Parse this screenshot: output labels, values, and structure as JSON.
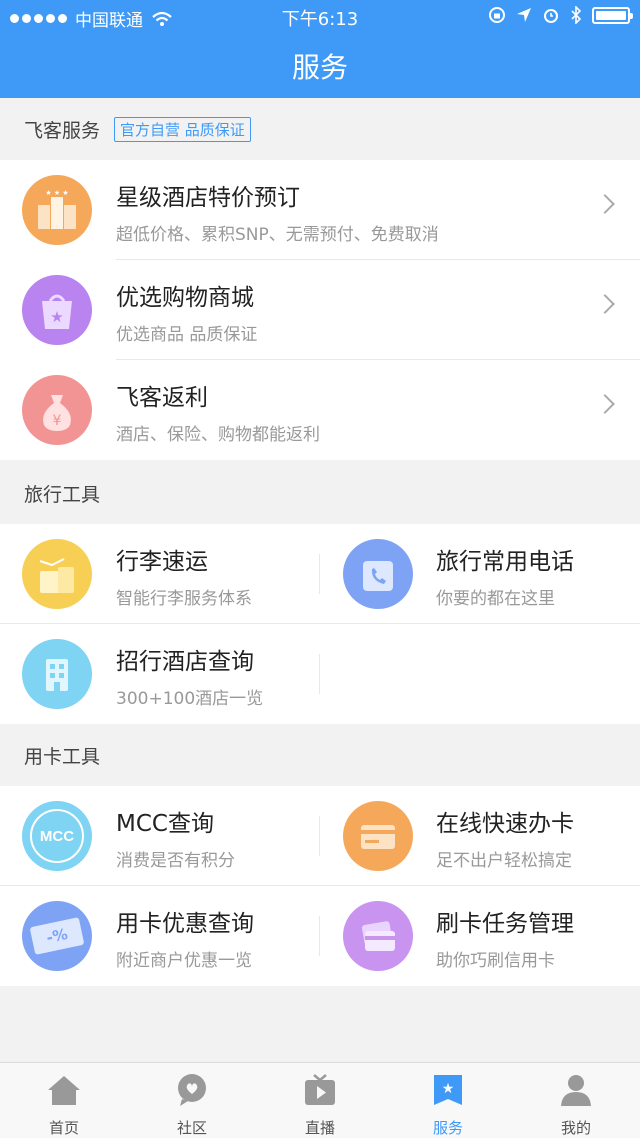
{
  "status": {
    "carrier": "中国联通",
    "time": "下午6:13"
  },
  "header": {
    "title": "服务"
  },
  "sections": {
    "feike": {
      "title": "飞客服务",
      "tag": "官方自营 品质保证"
    },
    "travel": {
      "title": "旅行工具"
    },
    "card": {
      "title": "用卡工具"
    }
  },
  "feike_items": [
    {
      "name": "星级酒店特价预订",
      "desc": "超低价格、累积SNP、无需预付、免费取消",
      "icon": "hotel-icon",
      "color": "#f6a85a"
    },
    {
      "name": "优选购物商城",
      "desc": "优选商品 品质保证",
      "icon": "shopping-bag-icon",
      "color": "#b983f0"
    },
    {
      "name": "飞客返利",
      "desc": "酒店、保险、购物都能返利",
      "icon": "money-bag-icon",
      "color": "#f39494"
    }
  ],
  "travel_items": [
    {
      "name": "行李速运",
      "desc": "智能行李服务体系",
      "icon": "luggage-icon",
      "color": "#f7cf55"
    },
    {
      "name": "旅行常用电话",
      "desc": "你要的都在这里",
      "icon": "phone-icon",
      "color": "#7ea3f5"
    },
    {
      "name": "招行酒店查询",
      "desc": "300+100酒店一览",
      "icon": "building-icon",
      "color": "#7fd3f3"
    }
  ],
  "card_items": [
    {
      "name": "MCC查询",
      "desc": "消费是否有积分",
      "icon": "mcc-icon",
      "badge": "MCC",
      "color": "#7fd3f3"
    },
    {
      "name": "在线快速办卡",
      "desc": "足不出户轻松搞定",
      "icon": "card-icon",
      "color": "#f6a85a"
    },
    {
      "name": "用卡优惠查询",
      "desc": "附近商户优惠一览",
      "icon": "discount-ticket-icon",
      "badge": "-%",
      "color": "#7ea3f5"
    },
    {
      "name": "刷卡任务管理",
      "desc": "助你巧刷信用卡",
      "icon": "cards-icon",
      "color": "#c993f0"
    }
  ],
  "tabs": [
    {
      "label": "首页",
      "icon": "home-icon"
    },
    {
      "label": "社区",
      "icon": "chat-icon"
    },
    {
      "label": "直播",
      "icon": "tv-icon"
    },
    {
      "label": "服务",
      "icon": "service-icon",
      "active": true
    },
    {
      "label": "我的",
      "icon": "user-icon"
    }
  ],
  "colors": {
    "brand": "#3f9af7"
  }
}
